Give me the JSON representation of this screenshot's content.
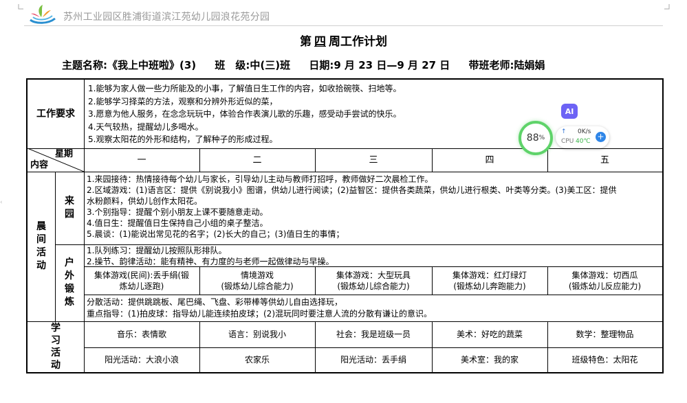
{
  "header": {
    "school_name": "苏州工业园区胜浦街道滨江苑幼儿园浪花苑分园"
  },
  "title": {
    "prefix": "第",
    "week": "四",
    "suffix": "周工作计划"
  },
  "info": {
    "theme": "主题名称:《我上中班啦》(3)",
    "class": "班　级:中(三)班",
    "date": "日期:9 月 23 日—9 月 27 日",
    "teacher": "带班老师:陆娟娟"
  },
  "table": {
    "requirements_label": "工作要求",
    "requirements": [
      "1.能够为家人做一些力所能及的小事，了解值日生工作的内容，如收拾碗筷、扫地等。",
      "2.能够学习择菜的方法，观察和分辨外形近似的菜，",
      "3.愿意为他人服务，在念念玩玩中，体验合作表演儿歌的乐趣，感受动手尝试的快乐。",
      "4.天气较热，提醒幼儿多喝水。",
      "5.观察太阳花的外形和结构，了解种子的形成过程。"
    ],
    "corner_top": "星期",
    "corner_bottom": "内容",
    "days": [
      "一",
      "二",
      "三",
      "四",
      "五"
    ],
    "morning_label": "晨间活动",
    "arrival_label": "来园",
    "arrival_lines": [
      "1.来园接待：热情接待每个幼儿与家长，引导幼儿主动与教师打招呼，教师做好二次晨检工作。",
      "2.区域游戏：(1)语言区：提供《别说我小》图谱，供幼儿进行阅读；(2)益智区：提供各类蔬菜，供幼儿进行根类、叶类等分类。(3)美工区：提供",
      "水粉颜料，供幼儿创作太阳花。",
      "3.个别指导：提醒个别小朋友上课不要随意走动。",
      "4.值日生：提醒值日生保持自己小组的桌子整洁。",
      "5.晨谈：(1)能说出常见花的名字；(2)长大的自己；(3)值日生的事情；"
    ],
    "outdoor_label": "户外锻炼",
    "outdoor_lines": [
      "1.队列练习：提醒幼儿按照队形排队。",
      "2.操节、韵律活动：能有精神、有力度的与老师一起做律动与早操。"
    ],
    "group_games": [
      {
        "name": "集体游戏(民间):丢手绢(锻",
        "goal": "炼幼儿逐跑)"
      },
      {
        "name": "情境游戏",
        "goal": "(锻炼幼儿综合能力)"
      },
      {
        "name": "集体游戏：大型玩具",
        "goal": "(锻炼幼儿综合能力)"
      },
      {
        "name": "集体游戏：红灯绿灯",
        "goal": "(锻炼幼儿奔跑能力)"
      },
      {
        "name": "集体游戏：切西瓜",
        "goal": "(锻炼幼儿反应能力)"
      }
    ],
    "free_lines": [
      "分散活动：提供跳跳板、尾巴绳、飞盘、彩带棒等供幼儿自由选择玩，",
      "重点指导：(1)拍皮球：指导幼儿能连续拍皮球；(2)混玩同时要注意人流的分散有谦让的意识。"
    ],
    "study_label": "学习活动",
    "study_row1": [
      "音乐：表情歌",
      "语言：别说我小",
      "社会：我是班级一员",
      "美术：好吃的蔬菜",
      "数学：整理物品"
    ],
    "study_row2": [
      "阳光活动：大浪小浪",
      "农家乐",
      "阳光活动：丢手绢",
      "美术室：我的家",
      "班级特色：太阳花"
    ]
  },
  "widget": {
    "ai_label": "AI",
    "cpu_percent": "88",
    "percent_sign": "%",
    "net_arrow": "↑",
    "net_speed": "0K/s",
    "cpu_label": "CPU",
    "temp": "40℃",
    "plus": "+"
  },
  "colors": {
    "gauge": "#5fd36a",
    "ai": "#6d63f5",
    "plus": "#2f86e8"
  }
}
